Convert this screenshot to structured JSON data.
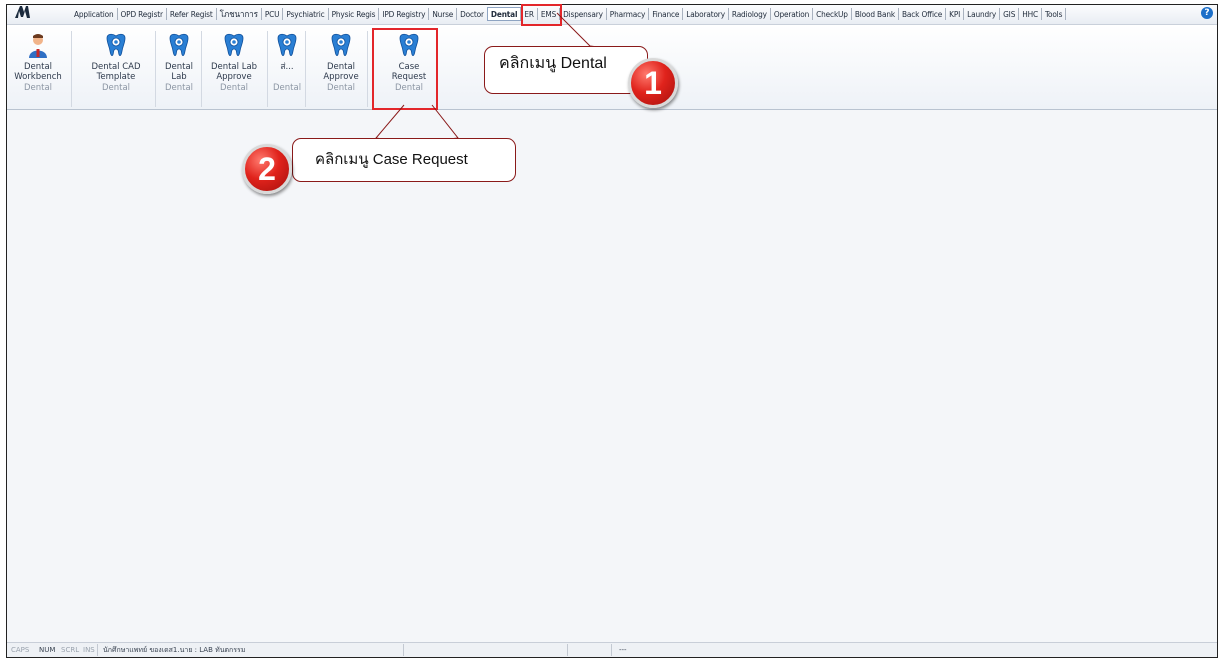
{
  "menubar": {
    "items": [
      "Application",
      "OPD Registr",
      "Refer Regist",
      "โภชนาการ",
      "PCU",
      "Psychiatric",
      "Physic Regis",
      "IPD Registry",
      "Nurse",
      "Doctor",
      "Dental",
      "ER",
      "EMS",
      "Dispensary",
      "Pharmacy",
      "Finance",
      "Laboratory",
      "Radiology",
      "Operation",
      "CheckUp",
      "Blood Bank",
      "Back Office",
      "KPI",
      "Laundry",
      "GIS",
      "HHC",
      "Tools"
    ],
    "active": "Dental",
    "help_label": "?"
  },
  "ribbon": {
    "buttons": [
      {
        "line1": "Dental",
        "line2": "Workbench",
        "group": "Dental",
        "icon": "dentist-person-icon"
      },
      {
        "line1": "Dental CAD",
        "line2": "Template",
        "group": "Dental",
        "icon": "tooth-icon"
      },
      {
        "line1": "Dental",
        "line2": "Lab",
        "group": "Dental",
        "icon": "tooth-icon"
      },
      {
        "line1": "Dental Lab",
        "line2": "Approve",
        "group": "Dental",
        "icon": "tooth-icon"
      },
      {
        "line1": "ส่...",
        "line2": "",
        "group": "Dental",
        "icon": "tooth-icon"
      },
      {
        "line1": "Dental",
        "line2": "Approve",
        "group": "Dental",
        "icon": "tooth-icon"
      },
      {
        "line1": "Case",
        "line2": "Request",
        "group": "Dental",
        "icon": "tooth-icon"
      }
    ]
  },
  "annotations": {
    "step1": {
      "number": "1",
      "text": "คลิกเมนู Dental"
    },
    "step2": {
      "number": "2",
      "text": "คลิกเมนู Case Request"
    }
  },
  "statusbar": {
    "caps": "CAPS",
    "num": "NUM",
    "scrl": "SCRL",
    "ins": "INS",
    "user": "นักศึกษาแพทย์ ของเดส1.นาย : LAB ทันตกรรม",
    "right": "---"
  },
  "colors": {
    "highlight": "#e3262a",
    "badge": "#e0231c",
    "tooth_blue": "#2a7fd4"
  }
}
